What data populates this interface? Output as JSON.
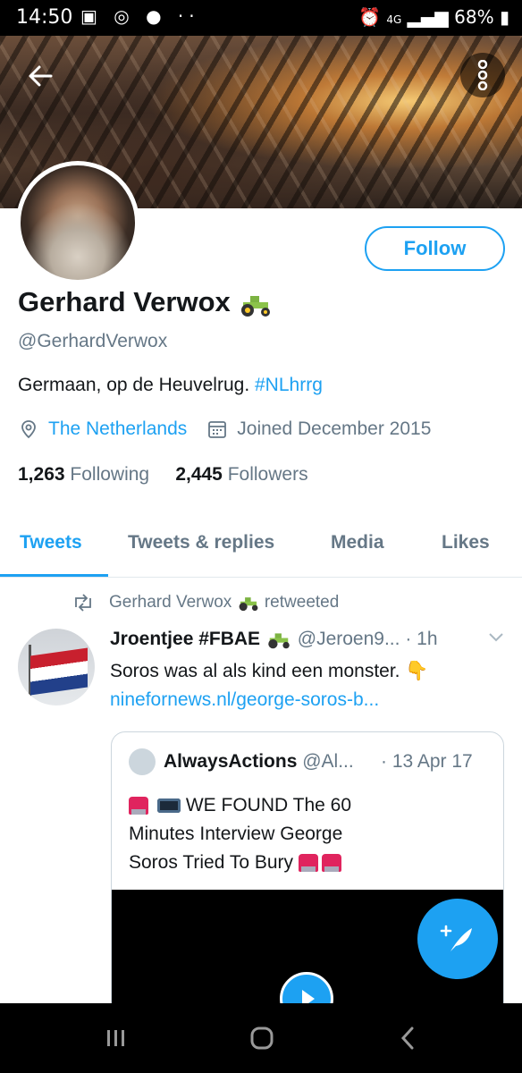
{
  "status_bar": {
    "time": "14:50",
    "network": "4G",
    "battery": "68%"
  },
  "profile": {
    "display_name": "Gerhard Verwox",
    "name_emoji": "tractor",
    "handle": "@GerhardVerwox",
    "bio_text": "Germaan, op de Heuvelrug.",
    "bio_hashtag": "#NLhrrg",
    "location": "The Netherlands",
    "joined": "Joined December 2015",
    "following_count": "1,263",
    "following_label": "Following",
    "followers_count": "2,445",
    "followers_label": "Followers",
    "follow_button": "Follow"
  },
  "tabs": [
    {
      "label": "Tweets",
      "active": true
    },
    {
      "label": "Tweets & replies",
      "active": false
    },
    {
      "label": "Media",
      "active": false
    },
    {
      "label": "Likes",
      "active": false
    }
  ],
  "tweet": {
    "retweet_by": "Gerhard Verwox",
    "retweet_suffix": "retweeted",
    "author_name": "Jroentjee #FBAE",
    "author_handle": "@Jeroen9...",
    "time": "· 1h",
    "text": "Soros was al als kind een monster.",
    "link": "ninefornews.nl/george-soros-b...",
    "quote": {
      "author_name": "AlwaysActions",
      "author_handle": "@Al...",
      "date": "· 13 Apr 17",
      "text_line1": "WE FOUND The 60",
      "text_line2": "Minutes Interview George",
      "text_line3": "Soros Tried To Bury"
    }
  },
  "colors": {
    "accent": "#1da1f2",
    "muted": "#657786"
  }
}
